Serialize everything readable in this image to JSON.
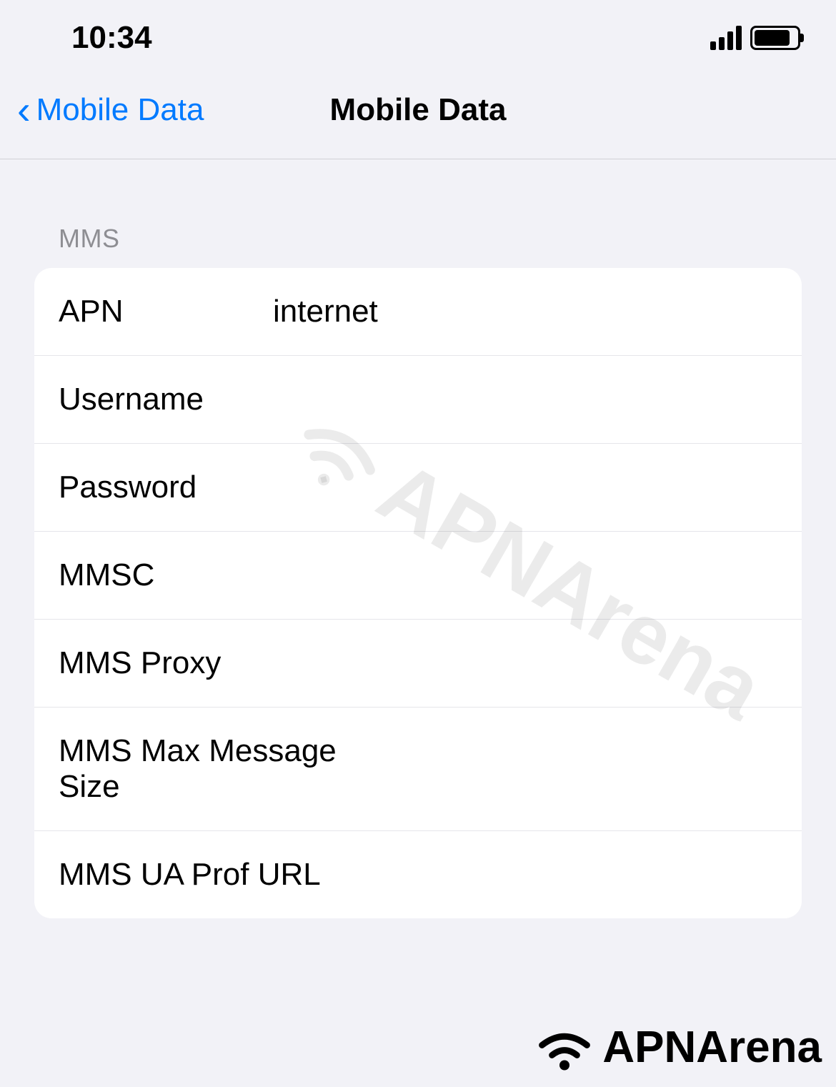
{
  "status": {
    "time": "10:34"
  },
  "nav": {
    "back_label": "Mobile Data",
    "title": "Mobile Data"
  },
  "section": {
    "header": "MMS"
  },
  "fields": {
    "apn": {
      "label": "APN",
      "value": "internet"
    },
    "username": {
      "label": "Username",
      "value": ""
    },
    "password": {
      "label": "Password",
      "value": ""
    },
    "mmsc": {
      "label": "MMSC",
      "value": ""
    },
    "mms_proxy": {
      "label": "MMS Proxy",
      "value": ""
    },
    "mms_max_size": {
      "label": "MMS Max Message Size",
      "value": ""
    },
    "mms_ua_prof": {
      "label": "MMS UA Prof URL",
      "value": ""
    }
  },
  "watermark": "APNArena",
  "brand": "APNArena"
}
